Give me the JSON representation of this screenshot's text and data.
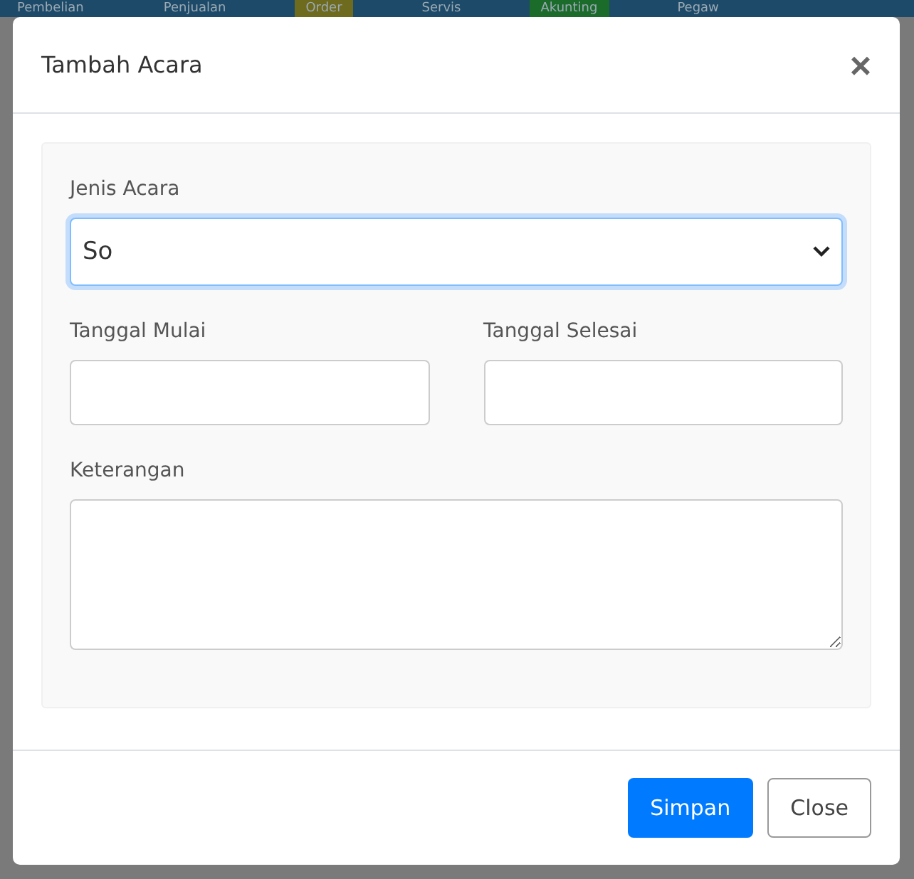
{
  "nav": [
    {
      "label": "Pembelian",
      "kind": "plain"
    },
    {
      "label": "Penjualan",
      "kind": "plain"
    },
    {
      "label": "Order",
      "kind": "order"
    },
    {
      "label": "Servis",
      "kind": "plain"
    },
    {
      "label": "Akunting",
      "kind": "account"
    },
    {
      "label": "Pegaw",
      "kind": "plain"
    }
  ],
  "modal": {
    "title": "Tambah Acara",
    "close_icon": "×",
    "fields": {
      "event_type": {
        "label": "Jenis Acara",
        "value": "So"
      },
      "start_date": {
        "label": "Tanggal Mulai"
      },
      "end_date": {
        "label": "Tanggal Selesai"
      },
      "notes": {
        "label": "Keterangan"
      }
    },
    "buttons": {
      "save": "Simpan",
      "close": "Close"
    }
  }
}
